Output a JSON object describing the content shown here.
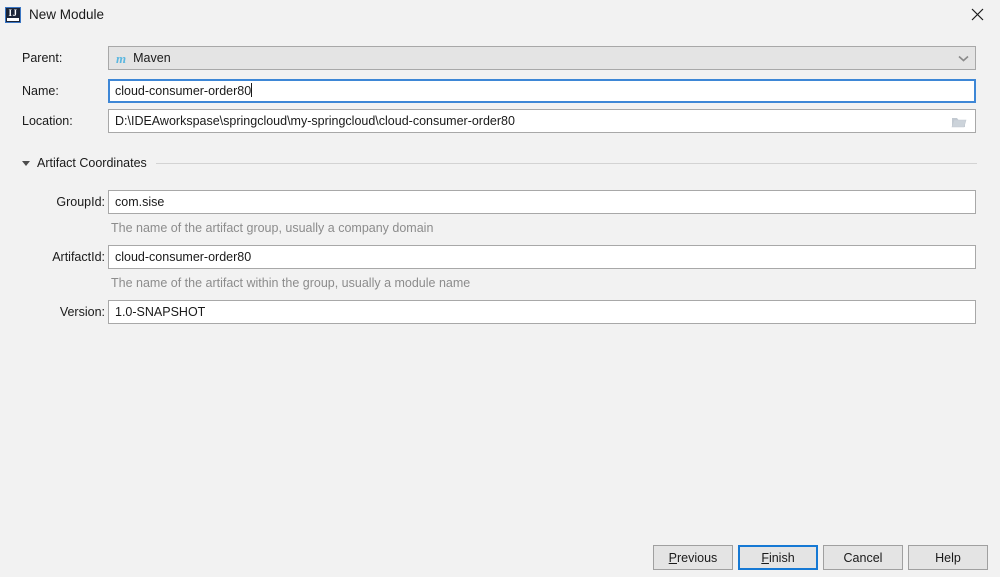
{
  "window": {
    "title": "New Module",
    "app_icon": "intellij-idea-icon",
    "close_icon": "close-icon"
  },
  "form": {
    "parent": {
      "label": "Parent:",
      "value": "Maven",
      "icon": "maven-icon",
      "arrow_icon": "chevron-down-icon"
    },
    "name": {
      "label": "Name:",
      "value": "cloud-consumer-order80",
      "focused": true
    },
    "location": {
      "label": "Location:",
      "value": "D:\\IDEAworkspase\\springcloud\\my-springcloud\\cloud-consumer-order80",
      "browse_icon": "folder-icon"
    }
  },
  "artifact_section": {
    "title": "Artifact Coordinates",
    "expanded": true,
    "collapse_icon": "triangle-down-icon",
    "fields": {
      "group_id": {
        "label": "GroupId:",
        "value": "com.sise",
        "hint": "The name of the artifact group, usually a company domain"
      },
      "artifact_id": {
        "label": "ArtifactId:",
        "value": "cloud-consumer-order80",
        "hint": "The name of the artifact within the group, usually a module name"
      },
      "version": {
        "label": "Version:",
        "value": "1.0-SNAPSHOT"
      }
    }
  },
  "buttons": {
    "previous": "Previous",
    "previous_mnemonic": "P",
    "finish": "Finish",
    "finish_mnemonic": "F",
    "cancel": "Cancel",
    "help": "Help"
  },
  "colors": {
    "dialog_bg": "#f2f2f2",
    "field_bg": "#ffffff",
    "field_border": "#a8a8a8",
    "focus_blue": "#3e87d6",
    "default_btn_blue": "#1679d4",
    "hint_gray": "#8c8c8c",
    "maven_blue": "#5bb7e0",
    "combo_bg": "#e4e4e4"
  }
}
